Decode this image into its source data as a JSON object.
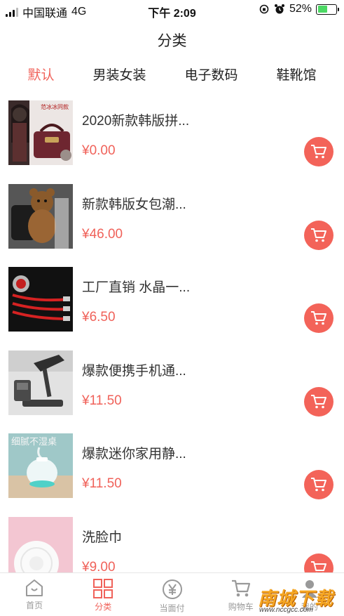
{
  "status_bar": {
    "carrier": "中国联通",
    "network": "4G",
    "time": "下午 2:09",
    "battery": "52%",
    "battery_level": 0.52
  },
  "header": {
    "title": "分类"
  },
  "tabs": [
    {
      "label": "默认",
      "active": true
    },
    {
      "label": "男装女装",
      "active": false
    },
    {
      "label": "电子数码",
      "active": false
    },
    {
      "label": "鞋靴馆",
      "active": false
    }
  ],
  "products": [
    {
      "title": "2020新款韩版拼...",
      "price": "¥0.00",
      "image": "handbag-photo",
      "image_caption": "范冰冰同款"
    },
    {
      "title": "新款韩版女包潮...",
      "price": "¥46.00",
      "image": "bear-backpack-photo"
    },
    {
      "title": "工厂直销 水晶一...",
      "price": "¥6.50",
      "image": "charging-cable-photo"
    },
    {
      "title": "爆款便携手机通...",
      "price": "¥11.50",
      "image": "phone-stand-photo"
    },
    {
      "title": "爆款迷你家用静...",
      "price": "¥11.50",
      "image": "humidifier-photo",
      "image_caption": "细腻不湿桌"
    },
    {
      "title": "洗脸巾",
      "price": "¥9.00",
      "image": "face-towel-roll-photo"
    }
  ],
  "bottom_nav": [
    {
      "label": "首页",
      "icon": "home-icon",
      "active": false
    },
    {
      "label": "分类",
      "icon": "grid-icon",
      "active": true
    },
    {
      "label": "当面付",
      "icon": "yen-icon",
      "active": false
    },
    {
      "label": "购物车",
      "icon": "cart-icon",
      "active": false
    },
    {
      "label": "我的",
      "icon": "person-icon",
      "active": false
    }
  ],
  "watermark": {
    "text": "南城下载",
    "url": "www.nccgcc.com"
  },
  "colors": {
    "accent": "#f0625a",
    "cart_button": "#f36359",
    "text": "#333333",
    "muted": "#999999"
  }
}
